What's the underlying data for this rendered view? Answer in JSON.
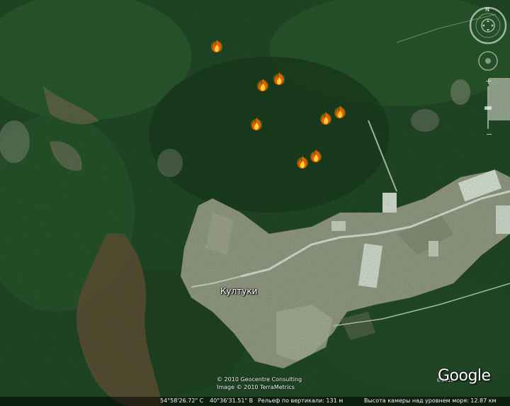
{
  "map": {
    "place_label": "Култуки",
    "markers": [
      {
        "type": "fire",
        "icon": "fire-icon"
      },
      {
        "type": "fire",
        "icon": "fire-icon"
      },
      {
        "type": "fire",
        "icon": "fire-icon"
      },
      {
        "type": "fire",
        "icon": "fire-icon"
      },
      {
        "type": "fire",
        "icon": "fire-icon"
      },
      {
        "type": "fire",
        "icon": "fire-icon"
      },
      {
        "type": "fire",
        "icon": "fire-icon"
      },
      {
        "type": "fire",
        "icon": "fire-icon"
      }
    ]
  },
  "credits": {
    "line1": "© 2010 Geocentre Consulting",
    "line2": "Image © 2010 TerraMetrics"
  },
  "logo": {
    "text": "Google",
    "year": "©2010"
  },
  "status_bar": {
    "latitude": "54°58'26.72\" С",
    "longitude": "40°36'31.51\" В",
    "elevation": "Рельеф по вертикали:  131 м",
    "eye_altitude": "Высота камеры над уровнем моря:   12.87 км"
  },
  "nav": {
    "compass_north": "N",
    "compass_icon": "compass-ring-icon",
    "look_icon": "look-joystick-icon",
    "zoom_icon": "zoom-slider-icon"
  },
  "colors": {
    "forest_dark": "#1f3a22",
    "forest": "#2e5430",
    "field": "#a9a59a",
    "bog": "#6b4a3a",
    "road": "#e9e9e4"
  }
}
